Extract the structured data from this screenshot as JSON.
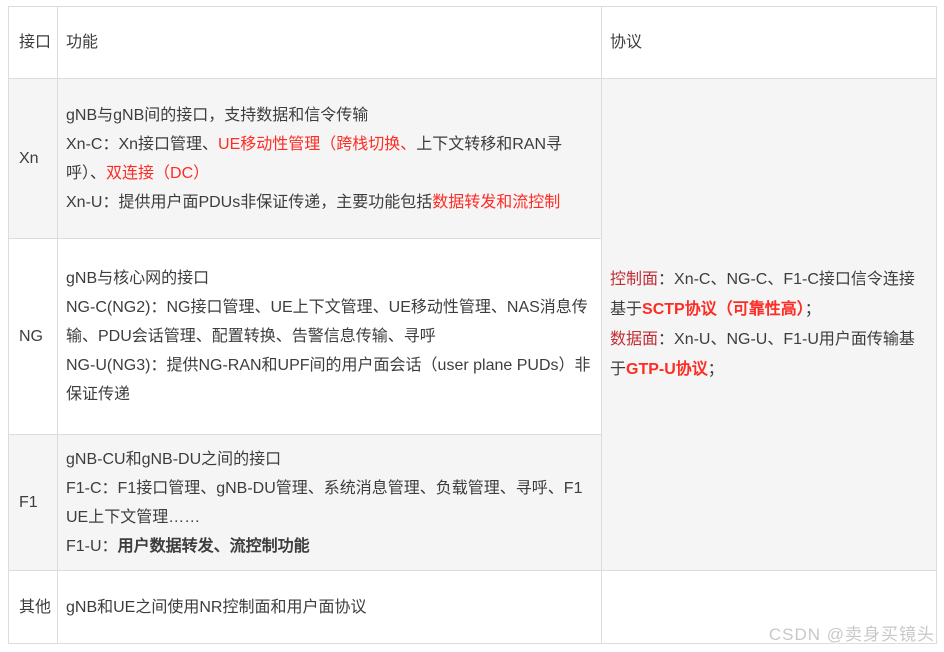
{
  "colors": {
    "red": "#fe2c24",
    "darkred": "#c12e35",
    "body_text": "#3d3d3d",
    "border": "#dcdcdc",
    "row_stripe": "#f5f5f5",
    "watermark": "#c8c8c8"
  },
  "table": {
    "headers": {
      "interface": "接口",
      "function": "功能",
      "protocol": "协议"
    },
    "rows": [
      {
        "interface": "Xn",
        "function": [
          [
            {
              "t": "gNB与gNB间的接口，支持数据和信令传输"
            }
          ],
          [
            {
              "t": "Xn-C：Xn接口管理、"
            },
            {
              "t": "UE移动性管理（跨栈切换、",
              "c": "red"
            },
            {
              "t": "上下文转移和RAN寻呼）、"
            },
            {
              "t": "双连接（DC）",
              "c": "red"
            }
          ],
          [
            {
              "t": "Xn-U：提供用户面PDUs非保证传递，主要功能包括"
            },
            {
              "t": "数据转发和流控制",
              "c": "red"
            }
          ]
        ]
      },
      {
        "interface": "NG",
        "function": [
          [
            {
              "t": "gNB与核心网的接口"
            }
          ],
          [
            {
              "t": "NG-C(NG2)：NG接口管理、UE上下文管理、UE移动性管理、NAS消息传输、PDU会话管理、配置转换、告警信息传输、寻呼"
            }
          ],
          [
            {
              "t": "NG-U(NG3)：提供NG-RAN和UPF间的用户面会话（user plane PUDs）非保证传递"
            }
          ]
        ]
      },
      {
        "interface": "F1",
        "function": [
          [
            {
              "t": "gNB-CU和gNB-DU之间的接口"
            }
          ],
          [
            {
              "t": "F1-C：F1接口管理、gNB-DU管理、系统消息管理、负载管理、寻呼、F1 UE上下文管理……"
            }
          ],
          [
            {
              "t": "F1-U："
            },
            {
              "t": "用户数据转发、流控制功能",
              "b": true
            }
          ]
        ]
      },
      {
        "interface": "其他",
        "function": [
          [
            {
              "t": "gNB和UE之间使用NR控制面和用户面协议"
            }
          ]
        ]
      }
    ],
    "protocol": [
      [
        {
          "t": "控制面",
          "c": "darkred"
        },
        {
          "t": "：Xn-C、NG-C、F1-C接口信令连接基于"
        },
        {
          "t": "SCTP协议（可靠性高）",
          "c": "red",
          "b": true
        },
        {
          "t": "；"
        }
      ],
      [
        {
          "t": "数据面",
          "c": "darkred"
        },
        {
          "t": "：Xn-U、NG-U、F1-U用户面传输基于"
        },
        {
          "t": "GTP-U协议",
          "c": "red",
          "b": true
        },
        {
          "t": "；"
        }
      ]
    ]
  },
  "watermark": {
    "text": "CSDN @卖身买镜头"
  }
}
